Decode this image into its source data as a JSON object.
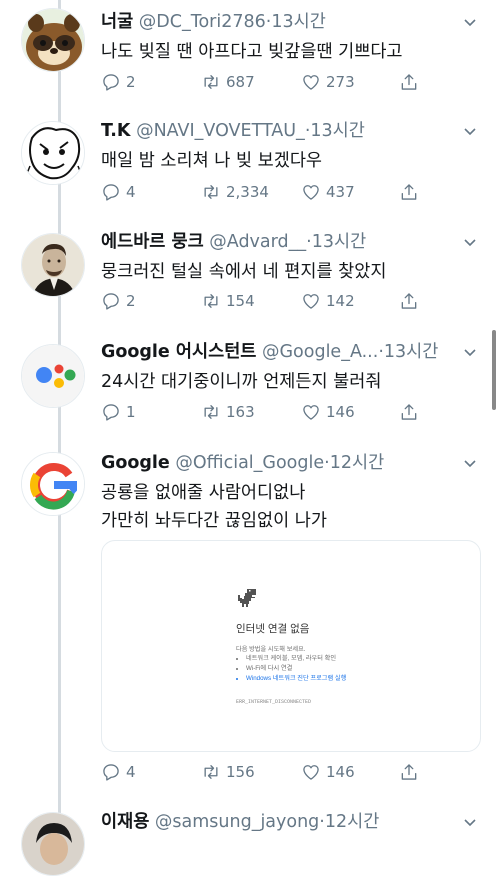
{
  "tweets": [
    {
      "name": "너굴",
      "handle": "@DC_Tori2786",
      "time": "13시간",
      "text": [
        "나도 빚질 땐 아프다고 빚갚을땐 기쁘다고"
      ],
      "replies": "2",
      "retweets": "687",
      "likes": "273"
    },
    {
      "name": "T.K",
      "handle": "@NAVI_VOVETTAU_",
      "time": "13시간",
      "text": [
        "매일 밤 소리쳐 나 빚 보겠다우"
      ],
      "replies": "4",
      "retweets": "2,334",
      "likes": "437"
    },
    {
      "name": "에드바르 뭉크",
      "handle": "@Advard__",
      "time": "13시간",
      "text": [
        "뭉크러진 털실 속에서 네 편지를 찾았지"
      ],
      "replies": "2",
      "retweets": "154",
      "likes": "142"
    },
    {
      "name": "Google 어시스턴트",
      "handle": "@Google_A...",
      "time": "13시간",
      "text": [
        "24시간 대기중이니까 언제든지 불러줘"
      ],
      "replies": "1",
      "retweets": "163",
      "likes": "146"
    },
    {
      "name": "Google",
      "handle": "@Official_Google",
      "time": "12시간",
      "text": [
        "공룡을 없애줄 사람어디없나",
        "가만히 놔두다간 끊임없이 나가"
      ],
      "replies": "4",
      "retweets": "156",
      "likes": "146"
    },
    {
      "name": "이재용",
      "handle": "@samsung_jayong",
      "time": "12시간"
    }
  ],
  "separator": "·",
  "card": {
    "title": "인터넷 연결 없음",
    "lead": "다음 방법을 시도해 보세요.",
    "items": [
      "네트워크 케이블, 모뎀, 라우터 확인",
      "Wi-Fi에 다시 연결",
      "Windows 네트워크 진단 프로그램 실행"
    ],
    "error_code": "ERR_INTERNET_DISCONNECTED"
  },
  "colors": {
    "text": "#14171a",
    "secondary": "#657786",
    "border": "#e6ecf0",
    "google_blue": "#4285F4",
    "google_red": "#EA4335",
    "google_yellow": "#FBBC05",
    "google_green": "#34A853"
  },
  "icons": {
    "reply": "reply-icon",
    "retweet": "retweet-icon",
    "like": "heart-icon",
    "share": "share-icon",
    "more": "chevron-down-icon"
  }
}
